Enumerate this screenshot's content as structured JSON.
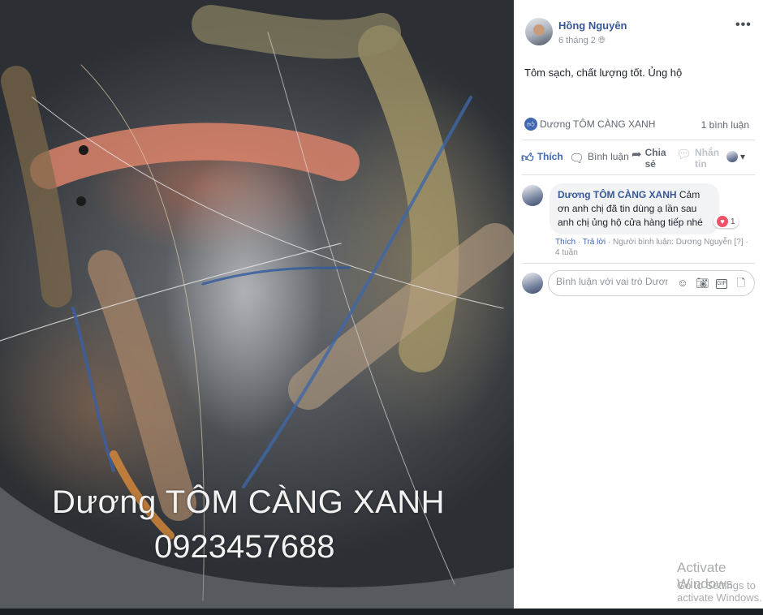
{
  "photo": {
    "watermark_name": "Dương TÔM CÀNG XANH",
    "watermark_phone": "0923457688"
  },
  "post": {
    "author": "Hồng Nguyên",
    "time": "6 tháng 2",
    "privacy_icon": "globe-icon",
    "text": "Tôm sạch, chất lượng tốt. Ủng hộ",
    "liked_by": "Dương TÔM CÀNG XANH",
    "comment_count": "1 bình luận",
    "more_label": "•••"
  },
  "actions": {
    "like": "Thích",
    "comment": "Bình luận",
    "share_line1": "Chia",
    "share_line2": "sẻ",
    "react_line1": "Nhắn",
    "react_line2": "tin",
    "dropdown": "▾"
  },
  "comment": {
    "author": "Dương TÔM CÀNG XANH",
    "text": " Cảm ơn anh chị đã tin dùng ạ lần sau anh chị ủng hộ cửa hàng tiếp nhé",
    "reaction_count": "1",
    "like_link": "Thích",
    "dot": " · ",
    "reply_link": "Trả lời",
    "dot2": " · ",
    "commenter_info": "Người bình luận: Dương Nguyễn",
    "help": " [?]",
    "age": " · 4 tuần"
  },
  "composer": {
    "placeholder": "Bình luận với vai trò Dươn..."
  },
  "os_watermark": {
    "line1": "Activate Windows",
    "line2": "Go to Settings to activate Windows."
  },
  "colors": {
    "link_blue": "#365899",
    "action_blue": "#4267b2",
    "panel_bg": "#ffffff"
  }
}
